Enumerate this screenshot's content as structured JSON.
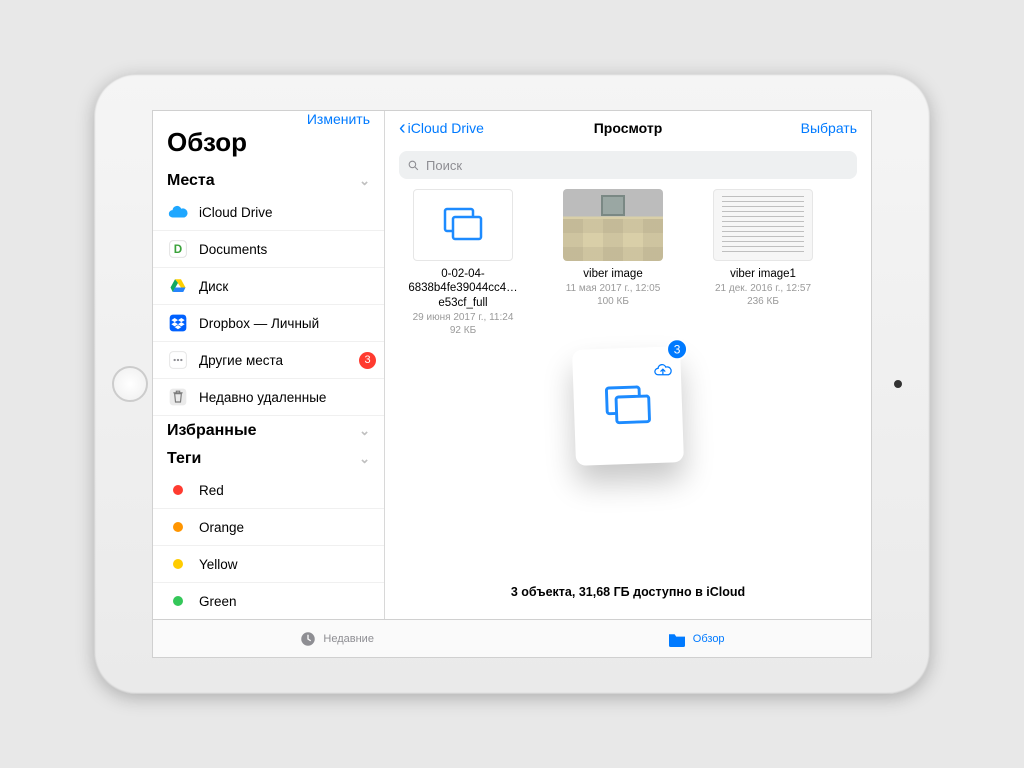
{
  "sidebar": {
    "edit_label": "Изменить",
    "title": "Обзор",
    "sections": {
      "places": {
        "header": "Места"
      },
      "favorites": {
        "header": "Избранные"
      },
      "tags": {
        "header": "Теги"
      }
    },
    "places": [
      {
        "label": "iCloud Drive"
      },
      {
        "label": "Documents"
      },
      {
        "label": "Диск"
      },
      {
        "label": "Dropbox — Личный"
      },
      {
        "label": "Другие места",
        "badge": "3"
      },
      {
        "label": "Недавно удаленные"
      }
    ],
    "tags": [
      {
        "label": "Red",
        "color": "#ff3b30"
      },
      {
        "label": "Orange",
        "color": "#ff9500"
      },
      {
        "label": "Yellow",
        "color": "#ffcc00"
      },
      {
        "label": "Green",
        "color": "#34c759"
      }
    ]
  },
  "main": {
    "back_label": "iCloud Drive",
    "title": "Просмотр",
    "select_label": "Выбрать",
    "search_placeholder": "Поиск",
    "files": [
      {
        "name": "0-02-04-6838b4fe39044cc4…e53cf_full",
        "date": "29 июня 2017 г., 11:24",
        "size": "92 КБ"
      },
      {
        "name": "viber image",
        "date": "11 мая 2017 г., 12:05",
        "size": "100 КБ"
      },
      {
        "name": "viber image1",
        "date": "21 дек. 2016 г., 12:57",
        "size": "236 КБ"
      }
    ],
    "popup_badge": "3",
    "status": "3 объекта, 31,68 ГБ доступно в iCloud"
  },
  "tabbar": {
    "recents": "Недавние",
    "browse": "Обзор"
  }
}
